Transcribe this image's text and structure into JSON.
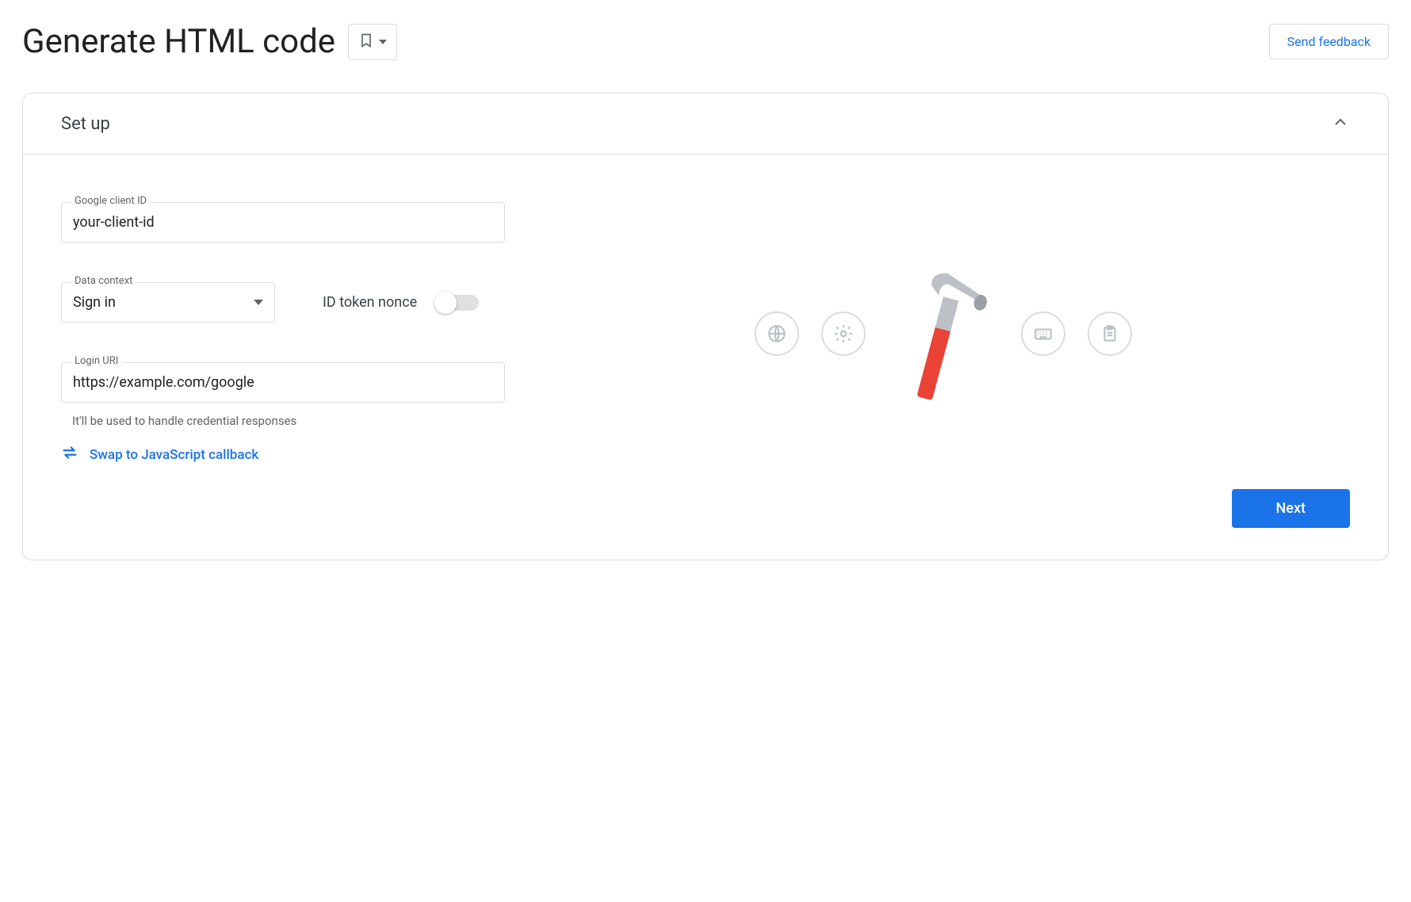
{
  "header": {
    "title": "Generate HTML code",
    "feedback_label": "Send feedback"
  },
  "panel": {
    "title": "Set up",
    "next_label": "Next"
  },
  "form": {
    "client_id": {
      "label": "Google client ID",
      "value": "your-client-id"
    },
    "data_context": {
      "label": "Data context",
      "value": "Sign in"
    },
    "nonce": {
      "label": "ID token nonce",
      "checked": false
    },
    "login_uri": {
      "label": "Login URI",
      "value": "https://example.com/google",
      "helper": "It'll be used to handle credential responses"
    },
    "swap_link": "Swap to JavaScript callback"
  }
}
